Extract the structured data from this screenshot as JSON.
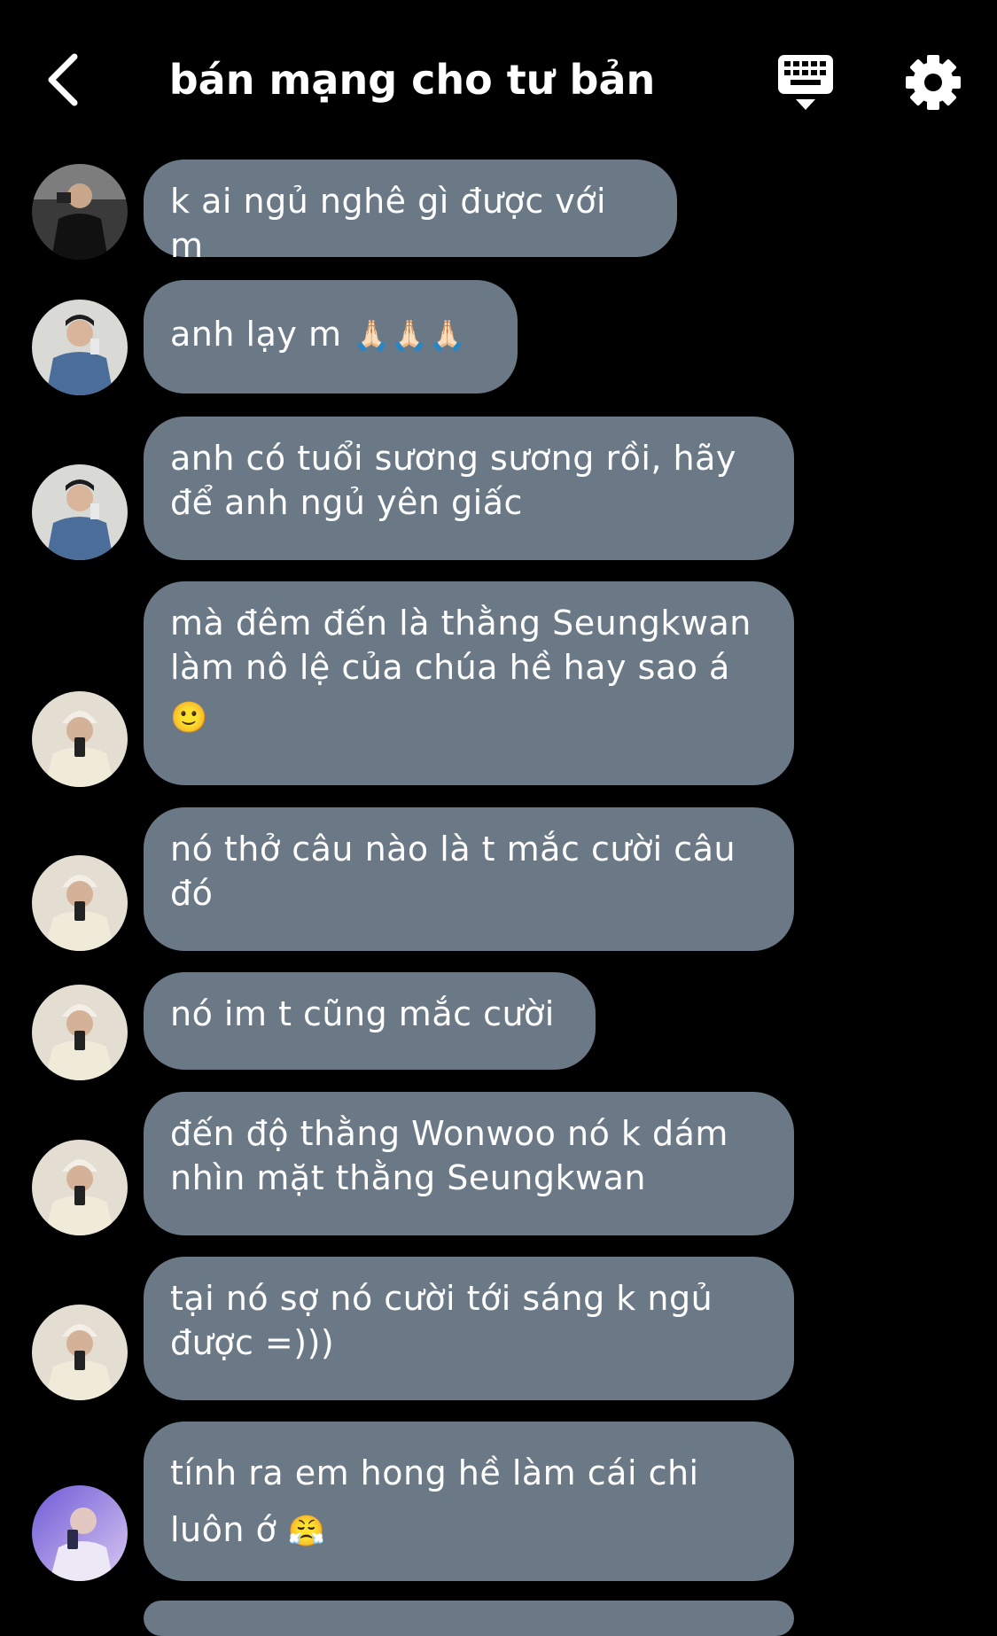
{
  "header": {
    "title": "bán mạng cho tư bản",
    "back_icon": "chevron-left-icon",
    "keyboard_icon": "keyboard-icon",
    "settings_icon": "gear-icon"
  },
  "colors": {
    "background": "#000000",
    "bubble": "#6b7886",
    "text": "#ffffff"
  },
  "messages": [
    {
      "text": "k ai ngủ nghê gì được với m",
      "avatar": "avatar-user-black-shirt"
    },
    {
      "text": "anh lạy m",
      "emoji": "🙏🏻🙏🏻🙏🏻",
      "avatar": "avatar-user-denim"
    },
    {
      "text": "anh có tuổi sương sương rồi, hãy để anh ngủ yên giấc",
      "avatar": "avatar-user-denim"
    },
    {
      "text": "mà đêm đến là thằng Seungkwan làm nô lệ của chúa hề hay sao á",
      "emoji": "🙂",
      "avatar": "avatar-user-beanie"
    },
    {
      "text": "nó thở câu nào là t mắc cười câu đó",
      "avatar": "avatar-user-beanie"
    },
    {
      "text": "nó im t cũng mắc cười",
      "avatar": "avatar-user-beanie"
    },
    {
      "text": "đến độ thằng Wonwoo nó k dám nhìn mặt thằng Seungkwan",
      "avatar": "avatar-user-beanie"
    },
    {
      "text": "tại nó sợ nó cười tới sáng k ngủ được =)))",
      "avatar": "avatar-user-beanie"
    },
    {
      "text": "tính ra em hong hề làm cái chi luôn ớ",
      "emoji": "😤",
      "avatar": "avatar-user-purple"
    }
  ]
}
